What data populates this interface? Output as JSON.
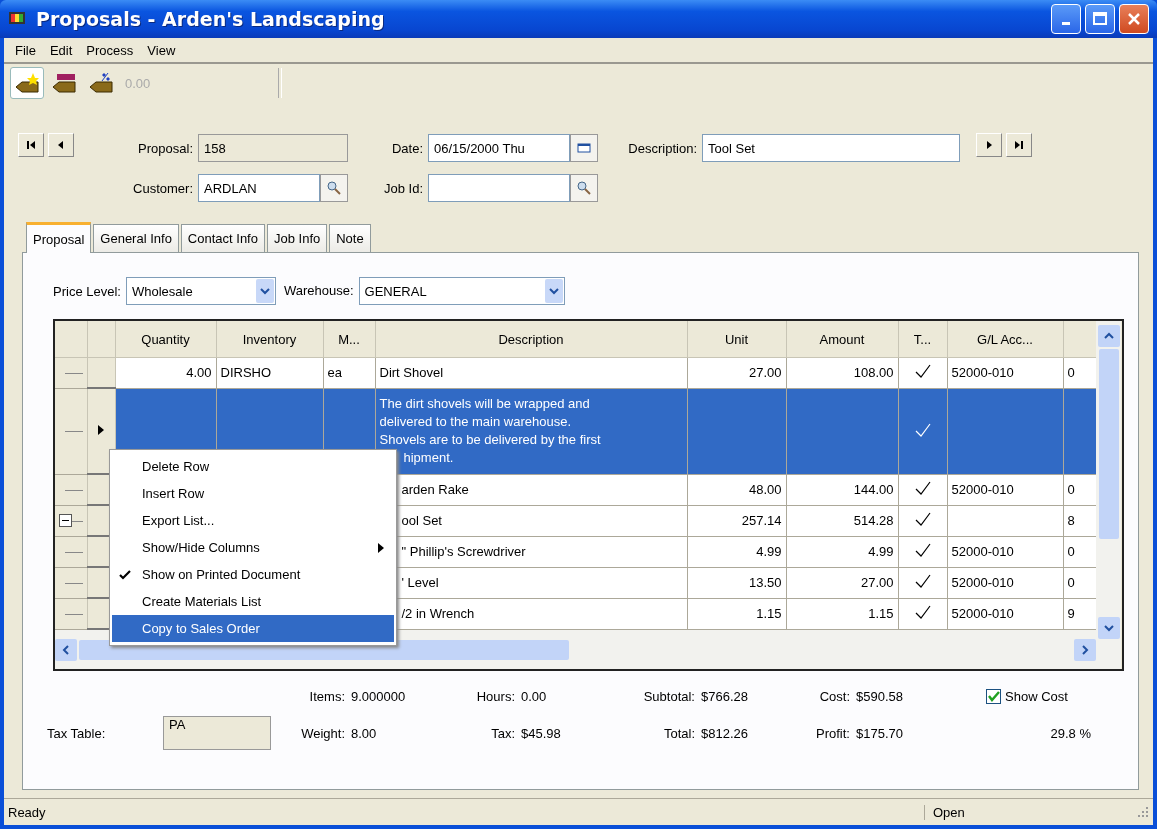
{
  "window": {
    "title": "Proposals - Arden's Landscaping"
  },
  "menu": [
    "File",
    "Edit",
    "Process",
    "View"
  ],
  "toolbar": {
    "buttons": [
      {
        "kind": "star-tag",
        "pressed": true
      },
      {
        "kind": "level-tag",
        "pressed": false
      },
      {
        "kind": "percent-tag",
        "pressed": false
      }
    ],
    "discount": {
      "value": "0.00",
      "disabled": true
    }
  },
  "header": {
    "proposal": {
      "label": "Proposal:",
      "value": "158"
    },
    "date": {
      "label": "Date:",
      "value": "06/15/2000 Thu"
    },
    "description": {
      "label": "Description:",
      "value": "Tool Set"
    },
    "customer": {
      "label": "Customer:",
      "value": "ARDLAN"
    },
    "job_id": {
      "label": "Job Id:"
    }
  },
  "tabs": [
    {
      "label": "Proposal",
      "selected": true
    },
    {
      "label": "General Info",
      "selected": false
    },
    {
      "label": "Contact Info",
      "selected": false
    },
    {
      "label": "Job Info",
      "selected": false
    },
    {
      "label": "Note",
      "selected": false
    }
  ],
  "price_level": {
    "label": "Price Level:",
    "value": "Wholesale"
  },
  "warehouse": {
    "label": "Warehouse:",
    "value": "GENERAL"
  },
  "grid": {
    "columns": [
      "Quantity",
      "Inventory",
      "M...",
      "Description",
      "Unit",
      "Amount",
      "T...",
      "G/L Acc..."
    ],
    "rows": [
      {
        "kind": "item",
        "quantity": "4.00",
        "inventory": "DIRSHO",
        "measure": "ea",
        "description": "Dirt Shovel",
        "unit": "27.00",
        "amount": "108.00",
        "taxable": true,
        "gl_account": "52000-010",
        "column_9": "0",
        "selected": false
      },
      {
        "kind": "memo",
        "lines": [
          "The dirt shovels will be wrapped and",
          "delivered to the main warehouse.",
          "Shovels are to be delivered by the first",
          "hipment."
        ],
        "taxable": true,
        "selected": true
      },
      {
        "kind": "item",
        "description": "arden Rake",
        "unit": "48.00",
        "amount": "144.00",
        "taxable": true,
        "gl_account": "52000-010",
        "column_9": "0",
        "selected": false
      },
      {
        "kind": "item",
        "description": "ool Set",
        "unit": "257.14",
        "amount": "514.28",
        "taxable": true,
        "column_9": "8",
        "selected": false,
        "expanded": true
      },
      {
        "kind": "item",
        "description": "\" Phillip's Screwdriver",
        "unit": "4.99",
        "amount": "4.99",
        "taxable": true,
        "gl_account": "52000-010",
        "column_9": "0",
        "selected": false
      },
      {
        "kind": "item",
        "description": "' Level",
        "unit": "13.50",
        "amount": "27.00",
        "taxable": true,
        "gl_account": "52000-010",
        "column_9": "0",
        "selected": false
      },
      {
        "kind": "item",
        "description": "/2 in Wrench",
        "unit": "1.15",
        "amount": "1.15",
        "taxable": true,
        "gl_account": "52000-010",
        "column_9": "9",
        "selected": false
      }
    ]
  },
  "context_menu": [
    {
      "label": "Delete Row",
      "checked": false,
      "submenu": false,
      "selected": false
    },
    {
      "label": "Insert Row",
      "checked": false,
      "submenu": false,
      "selected": false
    },
    {
      "label": "Export List...",
      "checked": false,
      "submenu": false,
      "selected": false
    },
    {
      "label": "Show/Hide Columns",
      "checked": false,
      "submenu": true,
      "selected": false
    },
    {
      "label": "Show on Printed Document",
      "checked": true,
      "submenu": false,
      "selected": false
    },
    {
      "label": "Create Materials List",
      "checked": false,
      "submenu": false,
      "selected": false
    },
    {
      "label": "Copy to Sales Order",
      "checked": false,
      "submenu": false,
      "selected": true
    }
  ],
  "totals": {
    "items": {
      "label": "Items:",
      "value": "9.000000"
    },
    "hours": {
      "label": "Hours:",
      "value": "0.00"
    },
    "subtotal": {
      "label": "Subtotal:",
      "value": "$766.28"
    },
    "cost": {
      "label": "Cost:",
      "value": "$590.58"
    },
    "show_cost": {
      "label": "Show Cost",
      "checked": true
    },
    "tax_table": {
      "label": "Tax Table:",
      "value": "PA"
    },
    "weight": {
      "label": "Weight:",
      "value": "8.00"
    },
    "tax": {
      "label": "Tax:",
      "value": "$45.98"
    },
    "total": {
      "label": "Total:",
      "value": "$812.26"
    },
    "profit": {
      "label": "Profit:",
      "value": "$175.70"
    },
    "percent": "29.8 %"
  },
  "status_bar": [
    "Ready",
    "Open"
  ]
}
